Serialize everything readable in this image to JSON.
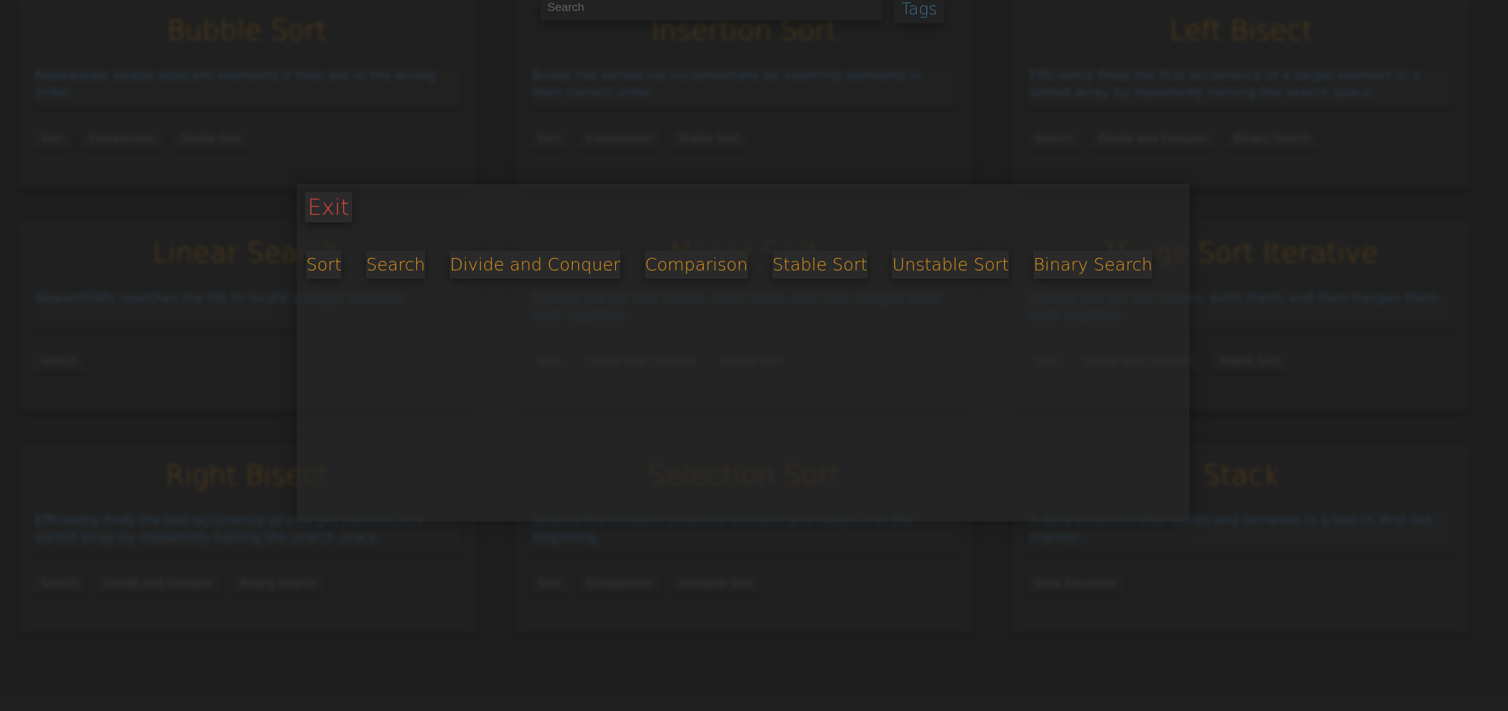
{
  "header": {
    "search_placeholder": "Search",
    "search_value": "",
    "tags_label": "Tags"
  },
  "colors": {
    "background": "#272727",
    "title_orange": "#e0951a",
    "desc_blue": "#4ea3e0",
    "exit_red": "#d9473c"
  },
  "cards": [
    {
      "title": "Bubble Sort",
      "description": "Repeatedly swaps adjacent elements if they are in the wrong order.",
      "tags": [
        "Sort",
        "Comparison",
        "Stable Sort"
      ]
    },
    {
      "title": "Insertion Sort",
      "description": "Builds the sorted list incrementally by inserting elements in their correct order.",
      "tags": [
        "Sort",
        "Comparison",
        "Stable Sort"
      ]
    },
    {
      "title": "Left Bisect",
      "description": "Efficiently finds the first occurrence of a target element in a sorted array by repeatedly halving the search space.",
      "tags": [
        "Search",
        "Divide and Conquer",
        "Binary Search"
      ]
    },
    {
      "title": "Linear Search",
      "description": "Sequentially searches the list to locate a target element.",
      "tags": [
        "Search"
      ]
    },
    {
      "title": "Merge Sort",
      "description": "Divides the list into halves, sorts them, and then merges them back together.",
      "tags": [
        "Sort",
        "Divide and Conquer",
        "Stable Sort"
      ]
    },
    {
      "title": "Merge Sort Iterative",
      "description": "Divides the list into halves, sorts them, and then merges them back together.",
      "tags": [
        "Sort",
        "Divide and Conquer",
        "Stable Sort"
      ]
    },
    {
      "title": "Right Bisect",
      "description": "Efficiently finds the last occurrence of a target element in a sorted array by repeatedly halving the search space.",
      "tags": [
        "Search",
        "Divide and Conquer",
        "Binary Search"
      ]
    },
    {
      "title": "Selection Sort",
      "description": "Selects the smallest unsorted element and swaps it at the beginning.",
      "tags": [
        "Sort",
        "Comparison",
        "Unstable Sort"
      ]
    },
    {
      "title": "Stack",
      "description": "A data structure that stores and retrieves in a last-in, first-out manner.",
      "tags": [
        "Data Structure"
      ]
    }
  ],
  "modal": {
    "exit_label": "Exit",
    "tags": [
      "Sort",
      "Search",
      "Divide and Conquer",
      "Comparison",
      "Stable Sort",
      "Unstable Sort",
      "Binary Search"
    ]
  }
}
